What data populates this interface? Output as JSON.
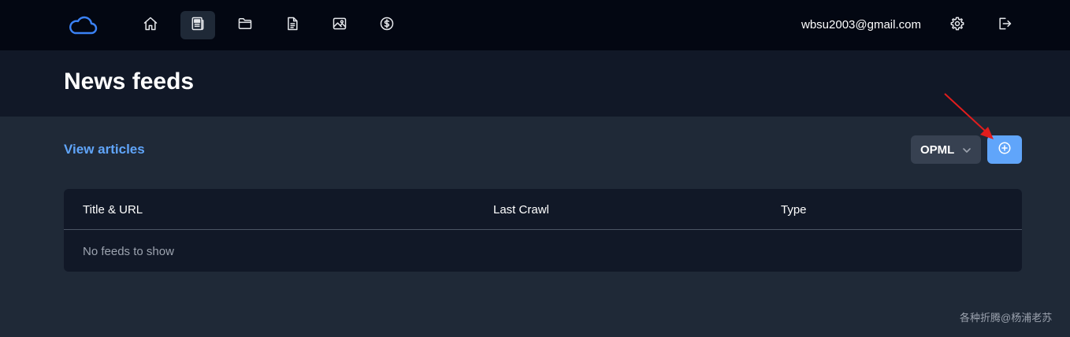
{
  "nav": {
    "logo_icon": "cloud-icon",
    "items": [
      {
        "icon": "home-icon",
        "active": false
      },
      {
        "icon": "newspaper-icon",
        "active": true
      },
      {
        "icon": "folder-icon",
        "active": false
      },
      {
        "icon": "document-icon",
        "active": false
      },
      {
        "icon": "image-icon",
        "active": false
      },
      {
        "icon": "dollar-icon",
        "active": false
      }
    ],
    "user_email": "wbsu2003@gmail.com",
    "settings_icon": "gear-icon",
    "logout_icon": "logout-icon"
  },
  "page": {
    "title": "News feeds",
    "view_articles_label": "View articles",
    "opml_label": "OPML",
    "add_icon": "plus-circle-icon"
  },
  "table": {
    "columns": [
      "Title & URL",
      "Last Crawl",
      "Type"
    ],
    "empty_text": "No feeds to show"
  },
  "watermark": "各种折腾@杨浦老苏",
  "colors": {
    "topbar_bg": "#030712",
    "header_bg": "#111827",
    "body_bg": "#1f2937",
    "accent": "#60a5fa",
    "annotation_arrow": "#e11d1d"
  }
}
